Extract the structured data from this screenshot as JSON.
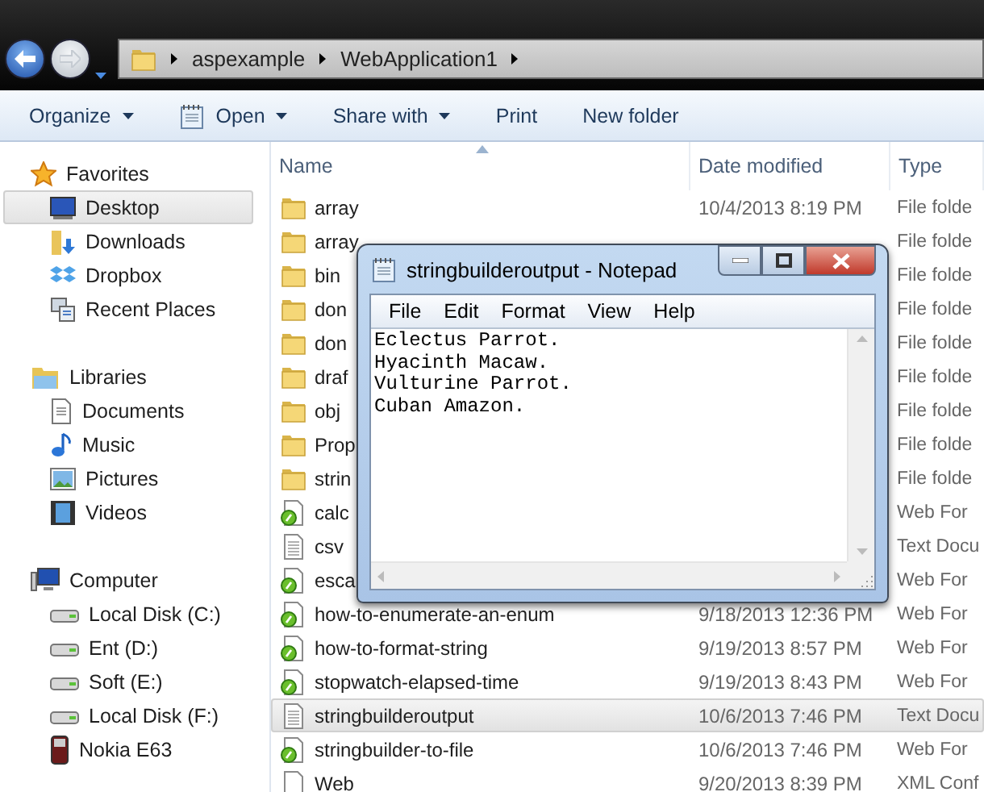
{
  "address": {
    "segments": [
      "aspexample",
      "WebApplication1"
    ]
  },
  "toolbar": [
    {
      "label": "Organize",
      "kind": "menu"
    },
    {
      "label": "Open",
      "kind": "open"
    },
    {
      "label": "Share with",
      "kind": "menu"
    },
    {
      "label": "Print",
      "kind": "plain"
    },
    {
      "label": "New folder",
      "kind": "plain"
    }
  ],
  "nav": [
    {
      "label": "Favorites",
      "kind": "star",
      "children": [
        {
          "label": "Desktop",
          "kind": "desktop",
          "selected": true
        },
        {
          "label": "Downloads",
          "kind": "downloads",
          "selected": false
        },
        {
          "label": "Dropbox",
          "kind": "dropbox",
          "selected": false
        },
        {
          "label": "Recent Places",
          "kind": "recent",
          "selected": false
        }
      ]
    },
    {
      "label": "Libraries",
      "kind": "library",
      "children": [
        {
          "label": "Documents",
          "kind": "documents",
          "selected": false
        },
        {
          "label": "Music",
          "kind": "music",
          "selected": false
        },
        {
          "label": "Pictures",
          "kind": "pictures",
          "selected": false
        },
        {
          "label": "Videos",
          "kind": "videos",
          "selected": false
        }
      ]
    },
    {
      "label": "Computer",
      "kind": "computer",
      "children": [
        {
          "label": "Local Disk (C:)",
          "kind": "disk",
          "selected": false
        },
        {
          "label": "Ent (D:)",
          "kind": "disk",
          "selected": false
        },
        {
          "label": "Soft (E:)",
          "kind": "disk",
          "selected": false
        },
        {
          "label": "Local Disk (F:)",
          "kind": "disk",
          "selected": false
        },
        {
          "label": "Nokia E63",
          "kind": "phone",
          "selected": false
        }
      ]
    }
  ],
  "columns": [
    "Name",
    "Date modified",
    "Type"
  ],
  "files": [
    {
      "name": "array",
      "date": "10/4/2013 8:19 PM",
      "type": "File folde",
      "kind": "folder",
      "selected": false
    },
    {
      "name": "array",
      "type": "File folde",
      "kind": "folder",
      "selected": false
    },
    {
      "name": "bin",
      "type": "File folde",
      "kind": "folder",
      "selected": false
    },
    {
      "name": "don",
      "type": "File folde",
      "kind": "folder",
      "selected": false
    },
    {
      "name": "don",
      "type": "File folde",
      "kind": "folder",
      "selected": false
    },
    {
      "name": "draf",
      "type": "File folde",
      "kind": "folder",
      "selected": false
    },
    {
      "name": "obj",
      "type": "File folde",
      "kind": "folder",
      "selected": false
    },
    {
      "name": "Prop",
      "type": "File folde",
      "kind": "folder",
      "selected": false
    },
    {
      "name": "strin",
      "type": "File folde",
      "kind": "folder",
      "selected": false
    },
    {
      "name": "calc",
      "type": "Web For",
      "kind": "webform",
      "selected": false
    },
    {
      "name": "csv",
      "type": "Text Docu",
      "kind": "text",
      "selected": false
    },
    {
      "name": "esca",
      "type": "Web For",
      "kind": "webform",
      "selected": false
    },
    {
      "name": "how-to-enumerate-an-enum",
      "date": "9/18/2013 12:36 PM",
      "type": "Web For",
      "kind": "webform",
      "selected": false
    },
    {
      "name": "how-to-format-string",
      "date": "9/19/2013 8:57 PM",
      "type": "Web For",
      "kind": "webform",
      "selected": false
    },
    {
      "name": "stopwatch-elapsed-time",
      "date": "9/19/2013 8:43 PM",
      "type": "Web For",
      "kind": "webform",
      "selected": false
    },
    {
      "name": "stringbuilderoutput",
      "date": "10/6/2013 7:46 PM",
      "type": "Text Docu",
      "kind": "text",
      "selected": true
    },
    {
      "name": "stringbuilder-to-file",
      "date": "10/6/2013 7:46 PM",
      "type": "Web For",
      "kind": "webform",
      "selected": false
    },
    {
      "name": "Web",
      "date": "9/20/2013 8:39 PM",
      "type": "XML Conf",
      "kind": "xml",
      "selected": false
    }
  ],
  "notepad": {
    "title": "stringbuilderoutput - Notepad",
    "menu": [
      "File",
      "Edit",
      "Format",
      "View",
      "Help"
    ],
    "lines": [
      "Eclectus Parrot.",
      "Hyacinth Macaw.",
      "Vulturine Parrot.",
      "Cuban Amazon."
    ]
  }
}
